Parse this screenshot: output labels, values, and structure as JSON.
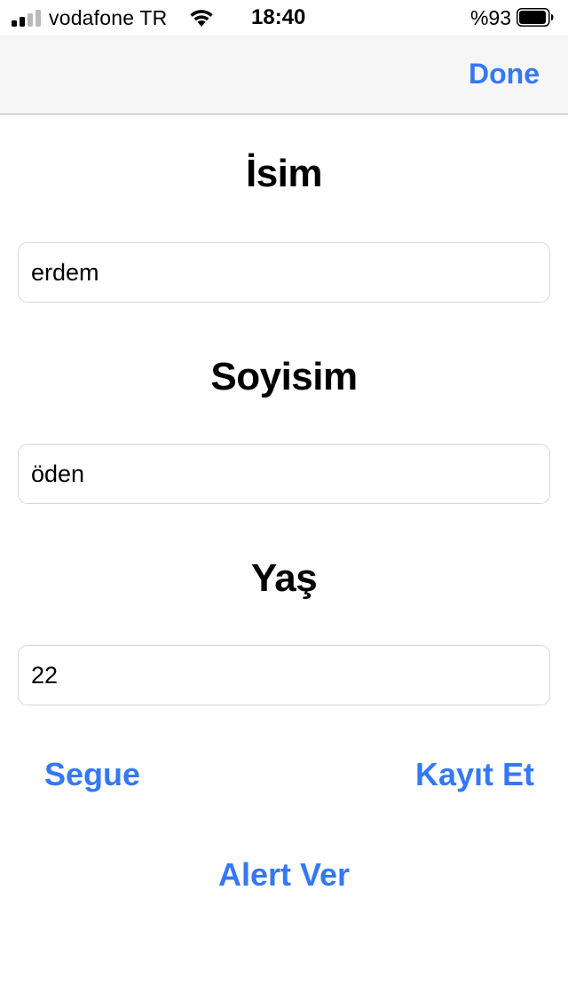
{
  "status_bar": {
    "carrier": "vodafone TR",
    "time": "18:40",
    "battery_percent": "%93",
    "signal_bars_active": 2,
    "signal_bars_total": 4,
    "battery_level": 0.93
  },
  "nav_bar": {
    "done_label": "Done"
  },
  "form": {
    "name_heading": "İsim",
    "name_value": "erdem",
    "surname_heading": "Soyisim",
    "surname_value": "öden",
    "age_heading": "Yaş",
    "age_value": "22"
  },
  "buttons": {
    "segue_label": "Segue",
    "save_label": "Kayıt Et",
    "alert_label": "Alert Ver"
  },
  "colors": {
    "accent": "#3478f6",
    "nav_background": "#f6f6f6",
    "field_border": "#d6d6d6",
    "signal_inactive": "#b9b9b9"
  }
}
